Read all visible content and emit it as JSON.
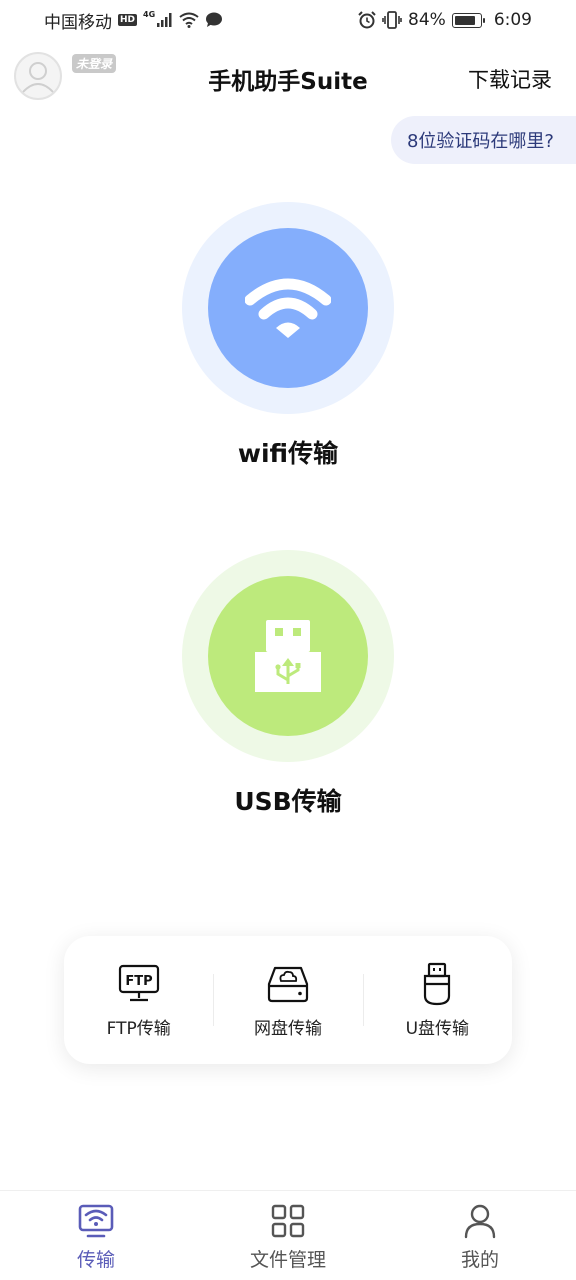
{
  "status_bar": {
    "carrier": "中国移动",
    "hd": "HD",
    "network": "4G",
    "battery_percent": "84%",
    "battery_level": 0.84,
    "time": "6:09"
  },
  "header": {
    "login_badge": "未登录",
    "title": "手机助手Suite",
    "download_records": "下载记录"
  },
  "help": {
    "question": "8位验证码在哪里?"
  },
  "transfer": {
    "wifi_label": "wifi传输",
    "usb_label": "USB传输"
  },
  "tools": [
    {
      "label": "FTP传输",
      "icon_text": "FTP"
    },
    {
      "label": "网盘传输"
    },
    {
      "label": "U盘传输"
    }
  ],
  "nav": [
    {
      "label": "传输",
      "active": true
    },
    {
      "label": "文件管理"
    },
    {
      "label": "我的"
    }
  ],
  "colors": {
    "wifi_disc": "#84aefc",
    "usb_disc": "#bdea7c",
    "nav_active": "#5a5cb8"
  }
}
